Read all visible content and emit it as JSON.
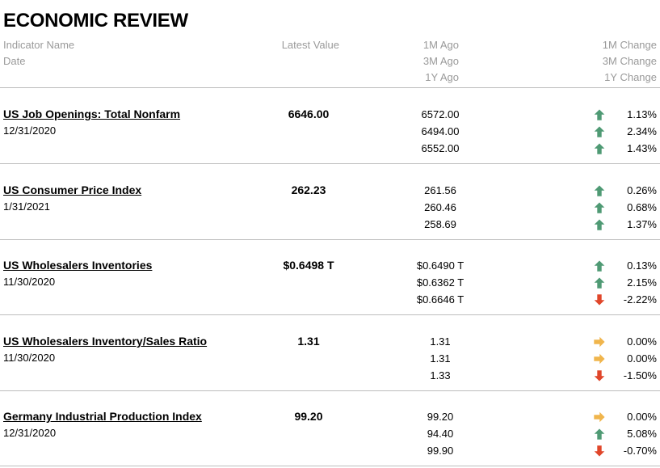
{
  "title": "ECONOMIC REVIEW",
  "headers": {
    "indicator_name": "Indicator Name",
    "date": "Date",
    "latest_value": "Latest Value",
    "ago_1m": "1M Ago",
    "ago_3m": "3M Ago",
    "ago_1y": "1Y Ago",
    "change_1m": "1M Change",
    "change_3m": "3M Change",
    "change_1y": "1Y Change"
  },
  "colors": {
    "up": "#4f9a74",
    "down": "#e0462a",
    "flat": "#f0b54c"
  },
  "indicators": [
    {
      "name": "US Job Openings: Total Nonfarm",
      "date": "12/31/2020",
      "latest": "6646.00",
      "ago": [
        "6572.00",
        "6494.00",
        "6552.00"
      ],
      "changes": [
        {
          "pct": "1.13%",
          "dir": "up"
        },
        {
          "pct": "2.34%",
          "dir": "up"
        },
        {
          "pct": "1.43%",
          "dir": "up"
        }
      ]
    },
    {
      "name": "US Consumer Price Index",
      "date": "1/31/2021",
      "latest": "262.23",
      "ago": [
        "261.56",
        "260.46",
        "258.69"
      ],
      "changes": [
        {
          "pct": "0.26%",
          "dir": "up"
        },
        {
          "pct": "0.68%",
          "dir": "up"
        },
        {
          "pct": "1.37%",
          "dir": "up"
        }
      ]
    },
    {
      "name": "US Wholesalers Inventories",
      "date": "11/30/2020",
      "latest": "$0.6498 T",
      "ago": [
        "$0.6490 T",
        "$0.6362 T",
        "$0.6646 T"
      ],
      "changes": [
        {
          "pct": "0.13%",
          "dir": "up"
        },
        {
          "pct": "2.15%",
          "dir": "up"
        },
        {
          "pct": "-2.22%",
          "dir": "down"
        }
      ]
    },
    {
      "name": "US Wholesalers Inventory/Sales Ratio",
      "date": "11/30/2020",
      "latest": "1.31",
      "ago": [
        "1.31",
        "1.31",
        "1.33"
      ],
      "changes": [
        {
          "pct": "0.00%",
          "dir": "flat"
        },
        {
          "pct": "0.00%",
          "dir": "flat"
        },
        {
          "pct": "-1.50%",
          "dir": "down"
        }
      ]
    },
    {
      "name": "Germany Industrial Production Index",
      "date": "12/31/2020",
      "latest": "99.20",
      "ago": [
        "99.20",
        "94.40",
        "99.90"
      ],
      "changes": [
        {
          "pct": "0.00%",
          "dir": "flat"
        },
        {
          "pct": "5.08%",
          "dir": "up"
        },
        {
          "pct": "-0.70%",
          "dir": "down"
        }
      ]
    }
  ]
}
